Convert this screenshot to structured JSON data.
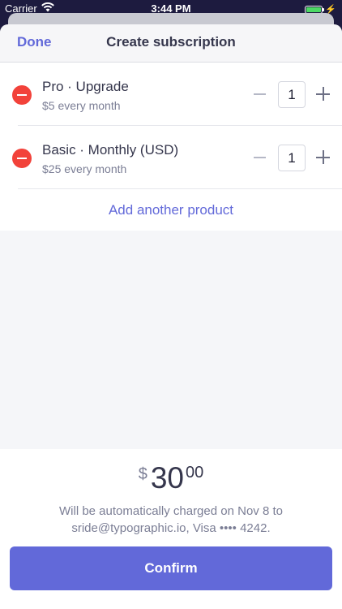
{
  "status_bar": {
    "carrier": "Carrier",
    "time": "3:44 PM",
    "battery_level": 1.0,
    "battery_color": "#4cd964"
  },
  "header": {
    "done_label": "Done",
    "title": "Create subscription"
  },
  "products": [
    {
      "name": "Pro · Upgrade",
      "price": "$5 every month",
      "quantity": "1"
    },
    {
      "name": "Basic · Monthly (USD)",
      "price": "$25 every month",
      "quantity": "1"
    }
  ],
  "add_product_label": "Add another product",
  "total": {
    "currency": "$",
    "amount": "30",
    "cents": "00"
  },
  "charge_note_line1": "Will be automatically charged on Nov 8 to",
  "charge_note_line2": "sride@typographic.io, Visa •••• 4242.",
  "confirm_label": "Confirm",
  "colors": {
    "accent": "#6269d9",
    "remove": "#f2423a",
    "text_primary": "#35364c",
    "text_secondary": "#7b7e95"
  },
  "icons": {
    "wifi": "wifi-icon",
    "battery": "battery-icon",
    "charging": "bolt-icon",
    "remove": "minus-circle-icon",
    "decrement": "minus-icon",
    "increment": "plus-icon"
  }
}
